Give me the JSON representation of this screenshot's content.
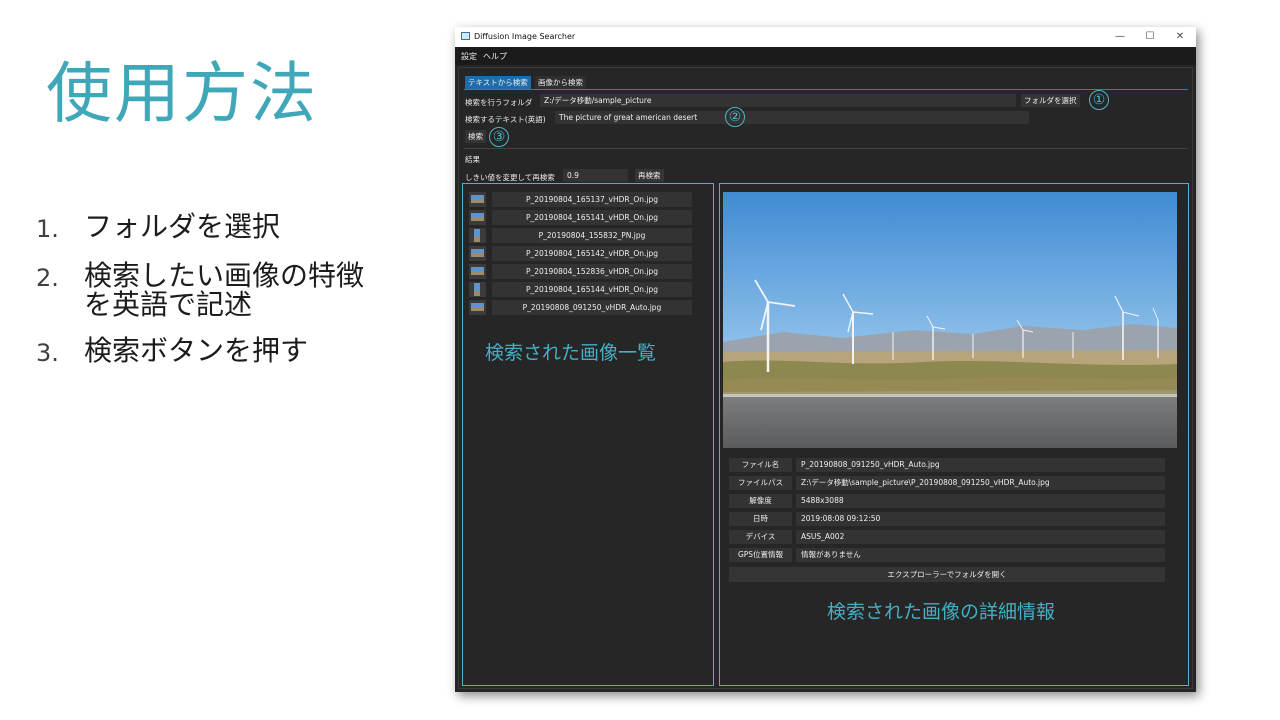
{
  "slide": {
    "title": "使用方法",
    "steps": [
      {
        "num": "1.",
        "text": "フォルダを選択"
      },
      {
        "num": "2.",
        "text": "検索したい画像の特徴を英語で記述"
      },
      {
        "num": "3.",
        "text": "検索ボタンを押す"
      }
    ]
  },
  "window": {
    "title": "Diffusion Image Searcher",
    "controls": {
      "minimize": "—",
      "maximize": "☐",
      "close": "✕"
    },
    "menu": [
      "設定",
      "ヘルプ"
    ],
    "tabs": [
      {
        "label": "テキストから検索",
        "active": true
      },
      {
        "label": "画像から検索",
        "active": false
      }
    ],
    "folder": {
      "label": "検索を行うフォルダ",
      "value": "Z:/データ移動/sample_picture",
      "button": "フォルダを選択",
      "marker": "①"
    },
    "query": {
      "label": "検索するテキスト(英語)",
      "value": "The picture of great american desert",
      "marker": "②"
    },
    "search": {
      "button": "検索",
      "marker": "③"
    },
    "results": {
      "label": "結果",
      "threshold_label": "しきい値を変更して再検索",
      "threshold_value": "0.9",
      "rerun_button": "再検索"
    },
    "result_list": [
      {
        "file": "P_20190804_165137_vHDR_On.jpg",
        "orientation": "landscape"
      },
      {
        "file": "P_20190804_165141_vHDR_On.jpg",
        "orientation": "landscape"
      },
      {
        "file": "P_20190804_155832_PN.jpg",
        "orientation": "portrait"
      },
      {
        "file": "P_20190804_165142_vHDR_On.jpg",
        "orientation": "landscape"
      },
      {
        "file": "P_20190804_152836_vHDR_On.jpg",
        "orientation": "landscape"
      },
      {
        "file": "P_20190804_165144_vHDR_On.jpg",
        "orientation": "portrait"
      },
      {
        "file": "P_20190808_091250_vHDR_Auto.jpg",
        "orientation": "landscape"
      }
    ],
    "list_caption": "検索された画像一覧",
    "details": {
      "rows": [
        {
          "key": "ファイル名",
          "value": "P_20190808_091250_vHDR_Auto.jpg"
        },
        {
          "key": "ファイルパス",
          "value": "Z:\\データ移動\\sample_picture\\P_20190808_091250_vHDR_Auto.jpg"
        },
        {
          "key": "解像度",
          "value": "5488x3088"
        },
        {
          "key": "日時",
          "value": "2019:08:08 09:12:50"
        },
        {
          "key": "デバイス",
          "value": "ASUS_A002"
        },
        {
          "key": "GPS位置情報",
          "value": "情報がありません"
        }
      ],
      "open_button": "エクスプローラーでフォルダを開く",
      "caption": "検索された画像の詳細情報"
    }
  },
  "colors": {
    "accent": "#3fa7b8",
    "tab_active": "#1e6ca8",
    "window_bg": "#262626"
  }
}
